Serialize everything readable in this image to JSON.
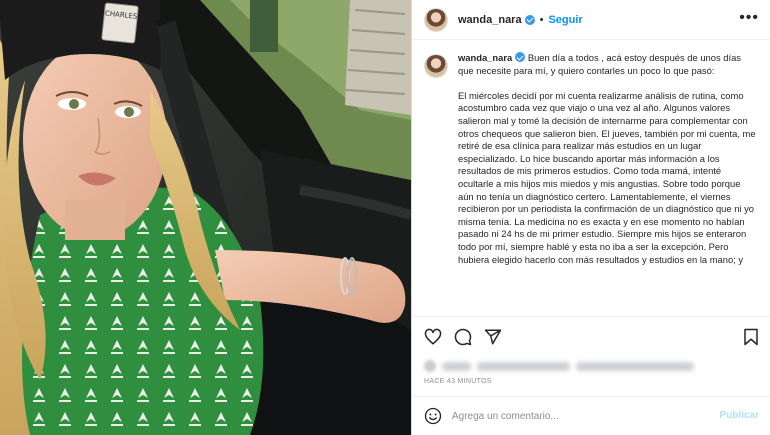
{
  "post": {
    "username": "wanda_nara",
    "dot": "•",
    "follow_label": "Seguir",
    "more_label": "•••"
  },
  "photo": {
    "beanie_label": "CHARLES"
  },
  "caption": {
    "username": "wanda_nara",
    "paragraphs": [
      "Buen día a todos , acá estoy después de unos días que necesite para mí, y quiero contarles un poco lo que pasó:",
      "El miércoles decidí por mi cuenta realizarme análisis de rutina, como acostumbro cada vez que viajo o una vez al año. Algunos valores salieron mal y tomé la decisión de internarme para complementar con otros chequeos que salieron bien. El jueves, también por mi cuenta, me retiré de esa clínica para realizar más estudios en un lugar especializado. Lo hice buscando aportar más información a los resultados de mis primeros estudios. Como toda mamá, intenté ocultarle a mis hijos mis miedos y mis angustias. Sobre todo porque aún no tenía un diagnóstico certero. Lamentablemente, el viernes recibieron por un periodista la confirmación de un diagnóstico que ni yo misma tenía. La medicina no es exacta y en ese momento no habían pasado ni 24 hs de mi primer estudio. Siempre mis hijos se enteraron todo por mí, siempre hablé y esta no iba a ser la excepción. Pero hubiera elegido hacerlo con más resultados y estudios en la mano; y"
    ]
  },
  "meta": {
    "time": "HACE 43 MINUTOS"
  },
  "comment": {
    "placeholder": "Agrega un comentario...",
    "publish_label": "Publicar"
  },
  "icons": [
    "heart-icon",
    "comment-icon",
    "share-icon",
    "bookmark-icon",
    "emoji-icon",
    "verified-icon",
    "more-icon"
  ],
  "colors": {
    "accent": "#0095f6",
    "verified": "#3897f0",
    "publish_disabled": "#b2dffc",
    "muted": "#8e8e8e",
    "shirt_green": "#2f8f3e"
  }
}
